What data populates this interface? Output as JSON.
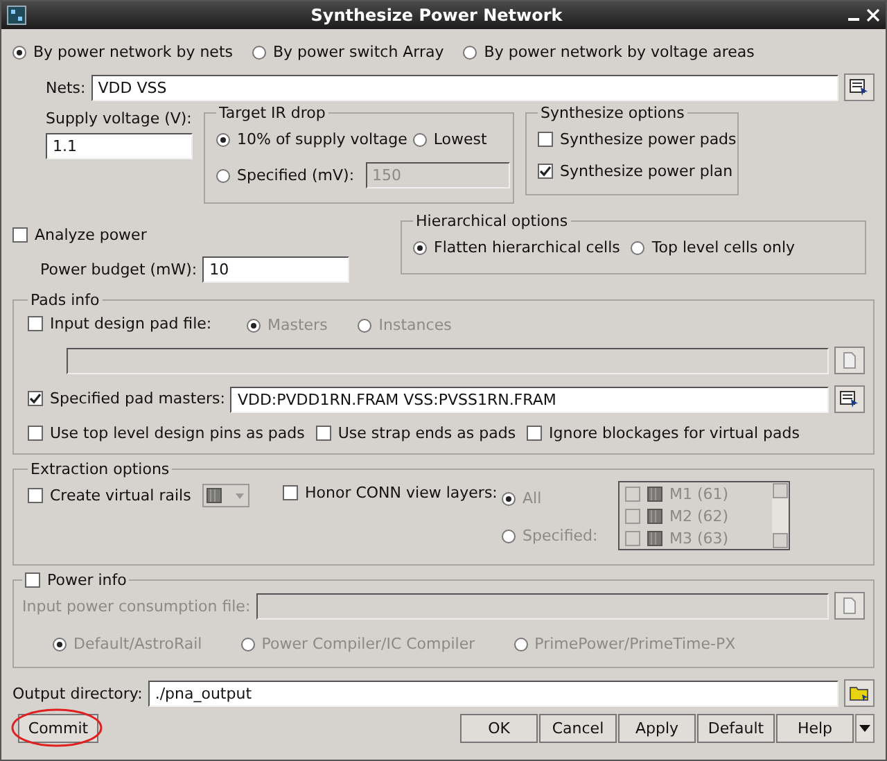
{
  "window": {
    "title": "Synthesize Power Network"
  },
  "modes": [
    {
      "label": "By power network by nets",
      "selected": true
    },
    {
      "label": "By power switch Array",
      "selected": false
    },
    {
      "label": "By power network by voltage areas",
      "selected": false
    }
  ],
  "nets": {
    "label": "Nets:",
    "value": "VDD VSS"
  },
  "supply_voltage": {
    "label": "Supply voltage (V):",
    "value": "1.1"
  },
  "target_ir_drop": {
    "title": "Target IR drop",
    "options": [
      {
        "label": "10% of supply voltage",
        "selected": true
      },
      {
        "label": "Lowest",
        "selected": false
      },
      {
        "label": "Specified (mV):",
        "selected": false
      }
    ],
    "specified_value": "150"
  },
  "synthesize_options": {
    "title": "Synthesize options",
    "items": [
      {
        "label": "Synthesize power pads",
        "checked": false
      },
      {
        "label": "Synthesize power plan",
        "checked": true
      }
    ]
  },
  "analyze_power": {
    "label": "Analyze power",
    "checked": false
  },
  "power_budget": {
    "label": "Power budget (mW):",
    "value": "10"
  },
  "hierarchical_options": {
    "title": "Hierarchical options",
    "options": [
      {
        "label": "Flatten hierarchical cells",
        "selected": true
      },
      {
        "label": "Top level cells only",
        "selected": false
      }
    ]
  },
  "pads_info": {
    "title": "Pads info",
    "input_design_pad_file": {
      "label": "Input design pad file:",
      "checked": false
    },
    "pad_file_modes": [
      {
        "label": "Masters",
        "selected": true
      },
      {
        "label": "Instances",
        "selected": false
      }
    ],
    "specified_pad_masters": {
      "label": "Specified pad masters:",
      "checked": true,
      "value": "VDD:PVDD1RN.FRAM VSS:PVSS1RN.FRAM"
    },
    "options": [
      {
        "label": "Use top level design pins as pads",
        "checked": false
      },
      {
        "label": "Use strap ends as pads",
        "checked": false
      },
      {
        "label": "Ignore blockages for virtual pads",
        "checked": false
      }
    ]
  },
  "extraction_options": {
    "title": "Extraction options",
    "create_virtual_rails": {
      "label": "Create virtual rails",
      "checked": false
    },
    "honor_conn_view_layers": {
      "label": "Honor CONN view layers:",
      "checked": false
    },
    "layer_modes": [
      {
        "label": "All",
        "selected": true
      },
      {
        "label": "Specified:",
        "selected": false
      }
    ],
    "layers": [
      {
        "label": "M1 (61)",
        "checked": false
      },
      {
        "label": "M2 (62)",
        "checked": false
      },
      {
        "label": "M3 (63)",
        "checked": false
      }
    ]
  },
  "power_info": {
    "title": "Power info",
    "checked": false,
    "file_label": "Input power consumption file:",
    "formats": [
      {
        "label": "Default/AstroRail",
        "selected": true
      },
      {
        "label": "Power Compiler/IC Compiler",
        "selected": false
      },
      {
        "label": "PrimePower/PrimeTime-PX",
        "selected": false
      }
    ]
  },
  "output_directory": {
    "label": "Output directory:",
    "value": "./pna_output"
  },
  "commit": {
    "label": "Commit",
    "highlighted": true
  },
  "buttons": [
    {
      "label": "OK"
    },
    {
      "label": "Cancel"
    },
    {
      "label": "Apply"
    },
    {
      "label": "Default"
    },
    {
      "label": "Help"
    }
  ]
}
